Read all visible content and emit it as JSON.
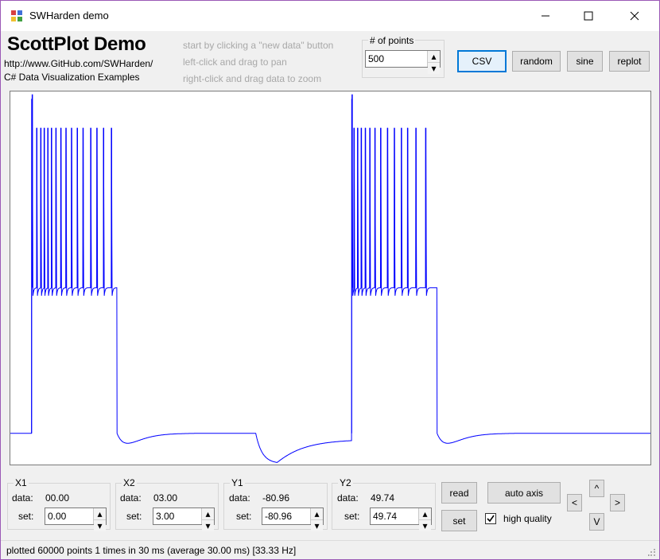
{
  "window": {
    "title": "SWHarden demo"
  },
  "header": {
    "heading": "ScottPlot Demo",
    "url": "http://www.GitHub.com/SWHarden/",
    "subtitle": "C# Data Visualization Examples",
    "hints": [
      "start by clicking a \"new data\" button",
      "left-click and drag to pan",
      "right-click and drag data to zoom"
    ]
  },
  "points": {
    "label": "# of points",
    "value": "500"
  },
  "toolbar": {
    "csv": "CSV",
    "random": "random",
    "sine": "sine",
    "replot": "replot"
  },
  "axes": [
    {
      "name": "X1",
      "data_label": "data:",
      "data": "00.00",
      "set_label": "set:",
      "set": "0.00"
    },
    {
      "name": "X2",
      "data_label": "data:",
      "data": "03.00",
      "set_label": "set:",
      "set": "3.00"
    },
    {
      "name": "Y1",
      "data_label": "data:",
      "data": "-80.96",
      "set_label": "set:",
      "set": "-80.96"
    },
    {
      "name": "Y2",
      "data_label": "data:",
      "data": "49.74",
      "set_label": "set:",
      "set": "49.74"
    }
  ],
  "controls": {
    "read": "read",
    "set": "set",
    "auto_axis": "auto axis",
    "high_quality": "high quality",
    "high_quality_checked": true,
    "nav_left": "<",
    "nav_right": ">",
    "nav_up": "^",
    "nav_down": "V"
  },
  "status": "plotted 60000 points 1 times in 30 ms (average 30.00 ms) [33.33 Hz]",
  "colors": {
    "trace": "#0000ff",
    "focus": "#0078d7"
  },
  "chart_data": {
    "type": "line",
    "title": "",
    "xlabel": "",
    "ylabel": "",
    "grid": false,
    "xlim": [
      0,
      3
    ],
    "ylim": [
      -80.96,
      49.74
    ],
    "baseline": -70,
    "sweeps": [
      {
        "step_on": 0.1,
        "step_off": 0.5,
        "spike_times": [
          0.103,
          0.124,
          0.143,
          0.159,
          0.176,
          0.193,
          0.214,
          0.237,
          0.261,
          0.287,
          0.314,
          0.341,
          0.377,
          0.406,
          0.437,
          0.474
        ]
      },
      {
        "step_on": 1.6,
        "step_off": 2.0,
        "spike_times": [
          1.602,
          1.611,
          1.628,
          1.645,
          1.664,
          1.685,
          1.709,
          1.736,
          1.768,
          1.8,
          1.833,
          1.862,
          1.901,
          1.947
        ]
      }
    ],
    "plateau_mv": -19,
    "spike_peak_mv": 37,
    "ahp_min_mv": -73.5,
    "hyperpolarization": {
      "start": 1.15,
      "end": 1.6,
      "min_mv": -80.6
    }
  }
}
